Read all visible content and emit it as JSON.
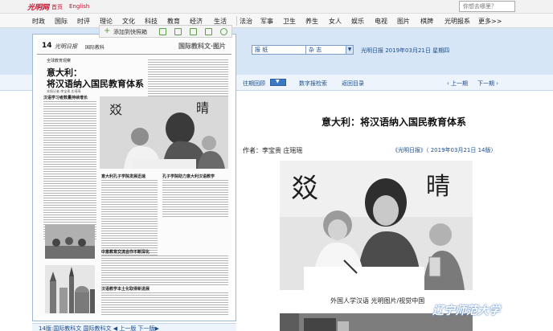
{
  "top": {
    "logo": "光明网",
    "links": [
      "首页",
      "English"
    ],
    "search_placeholder": "你想去哪里？"
  },
  "nav": {
    "items": [
      "时政",
      "国际",
      "时评",
      "理论",
      "文化",
      "科技",
      "教育",
      "经济",
      "生活",
      "法治",
      "军事",
      "卫生",
      "养生",
      "女人",
      "娱乐",
      "电视",
      "图片",
      "棋牌",
      "光明报系",
      "更多>>"
    ]
  },
  "tools": {
    "add_label": "添加到快照箱"
  },
  "selectors": {
    "paper": "报 纸",
    "magazine": "杂 志"
  },
  "date_text": "光明日报 2019年03月21日 星期四",
  "subbar": {
    "archive": "往期回顾",
    "search": "数字报检索",
    "back": "返回目录",
    "prev": "上一期",
    "next": "下一期"
  },
  "newspaper": {
    "page_number": "14",
    "logo": "光明日报",
    "section": "国际教科",
    "side_title": "国际教科文·图片",
    "col_header": "全球教育观察",
    "headline_line1": "意大利：",
    "headline_line2": "将汉语纳入国民教育体系",
    "byline": "本报记者 李宝贵 庄瑶瑶",
    "subheads": [
      "汉语学习者数量持续增长",
      "意大利孔子学院发展迅速",
      "孔子学院助力意大利汉语教学",
      "中意教育交流合作不断深化",
      "汉语教学本土化取得新进展"
    ]
  },
  "article": {
    "title": "意大利：将汉语纳入国民教育体系",
    "author": "作者：李宝贵 庄瑶瑶",
    "source": "《光明日报》（ 2019年03月21日 14版）",
    "caption": "外国人学汉语 光明图片/视觉中国"
  },
  "bottom": {
    "text": "14版:国际教科文 国际教科文 ◀ 上一版 下一版▶"
  },
  "watermark": "辽宁师范大学"
}
